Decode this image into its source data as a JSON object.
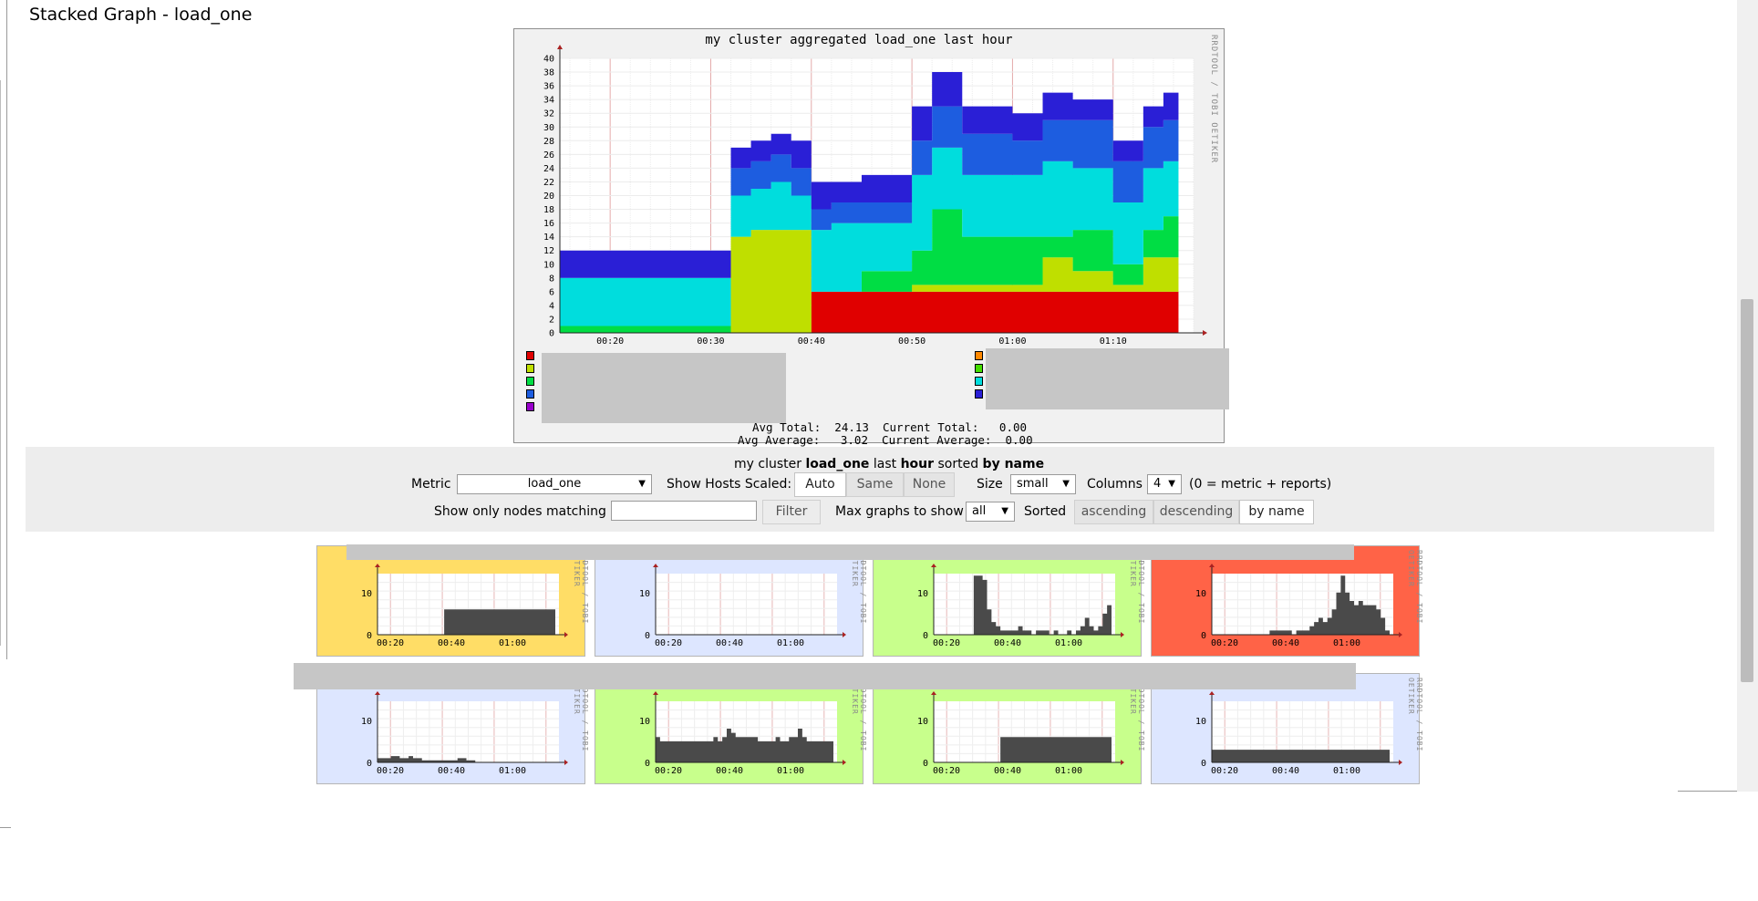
{
  "page": {
    "title": "Stacked Graph - load_one"
  },
  "main_graph": {
    "title": "my cluster aggregated load_one last hour",
    "credit": "RRDTOOL / TOBI OETIKER",
    "stats": {
      "line1": "Avg Total:  24.13  Current Total:   0.00",
      "line2": "Avg Average:   3.02  Current Average:  0.00"
    },
    "legend_colors_left": [
      "#e00000",
      "#bfdf00",
      "#00dd44",
      "#1d5de0",
      "#9900cc"
    ],
    "legend_colors_right": [
      "#ff8800",
      "#44dd00",
      "#00dddd",
      "#2a1fd6"
    ]
  },
  "chart_data": {
    "type": "area",
    "title": "my cluster aggregated load_one last hour",
    "stacked": true,
    "ylim": [
      0,
      40
    ],
    "y_ticks": [
      "0",
      "2",
      "4",
      "6",
      "8",
      "10",
      "12",
      "14",
      "16",
      "18",
      "20",
      "22",
      "24",
      "26",
      "28",
      "30",
      "32",
      "34",
      "36",
      "38",
      "40"
    ],
    "x_ticks": [
      "00:20",
      "00:30",
      "00:40",
      "00:50",
      "01:00",
      "01:10"
    ],
    "x_minutes": [
      15,
      20,
      25,
      30,
      32,
      34,
      36,
      38,
      40,
      42,
      45,
      50,
      52,
      55,
      60,
      63,
      66,
      70,
      73,
      75
    ],
    "series": [
      {
        "color": "#e00000",
        "values": [
          0,
          0,
          0,
          0,
          0,
          0,
          0,
          0,
          6,
          6,
          6,
          6,
          6,
          6,
          6,
          6,
          6,
          6,
          6,
          6
        ]
      },
      {
        "color": "#bfdf00",
        "values": [
          0,
          0,
          0,
          0,
          14,
          15,
          15,
          15,
          0,
          0,
          0,
          1,
          1,
          1,
          1,
          5,
          3,
          1,
          5,
          5
        ]
      },
      {
        "color": "#00dd44",
        "values": [
          1,
          1,
          1,
          1,
          0,
          0,
          0,
          0,
          0,
          0,
          3,
          5,
          11,
          7,
          7,
          3,
          6,
          3,
          4,
          6
        ]
      },
      {
        "color": "#00dddd",
        "values": [
          7,
          7,
          7,
          7,
          6,
          6,
          7,
          5,
          9,
          10,
          7,
          11,
          9,
          9,
          9,
          11,
          9,
          9,
          9,
          8
        ]
      },
      {
        "color": "#1d5de0",
        "values": [
          0,
          0,
          0,
          0,
          4,
          4,
          4,
          4,
          3,
          3,
          3,
          5,
          6,
          6,
          5,
          6,
          7,
          6,
          6,
          6
        ]
      },
      {
        "color": "#2a1fd6",
        "values": [
          4,
          4,
          4,
          4,
          3,
          3,
          3,
          4,
          4,
          3,
          4,
          5,
          5,
          4,
          4,
          4,
          3,
          3,
          3,
          4
        ]
      }
    ]
  },
  "controls": {
    "summary": {
      "prefix": "my cluster ",
      "metric": "load_one",
      "mid": " last ",
      "range": "hour",
      "sorted": " sorted ",
      "sort_by": "by name"
    },
    "metric_label": "Metric",
    "metric_value": "load_one",
    "scaled_label": "Show Hosts Scaled:",
    "scaled_options": [
      "Auto",
      "Same",
      "None"
    ],
    "size_label": "Size",
    "size_value": "small",
    "columns_label": "Columns",
    "columns_value": "4",
    "columns_note": "(0 = metric + reports)",
    "filter_label": "Show only nodes matching",
    "filter_value": "",
    "filter_button": "Filter",
    "max_graphs_label": "Max graphs to show",
    "max_graphs_value": "all",
    "sorted_label": "Sorted",
    "sort_options": [
      "ascending",
      "descending",
      "by name"
    ]
  },
  "thumbnails": {
    "y_ticks": [
      "0",
      "10"
    ],
    "x_ticks": [
      "00:20",
      "00:40",
      "01:00"
    ],
    "credit": "RRDTOOL / TOBI OETIKER",
    "items": [
      {
        "bg": "#ffdd66",
        "values": [
          0,
          0,
          0,
          0,
          0,
          0,
          0,
          0,
          0,
          0,
          0,
          0,
          0,
          0,
          0,
          6,
          6,
          6,
          6,
          6,
          6,
          6,
          6,
          6,
          6,
          6,
          6,
          6,
          6,
          6,
          6,
          6,
          6,
          6,
          6,
          6,
          6,
          6,
          6,
          6
        ]
      },
      {
        "bg": "#dde6ff",
        "values": [
          0,
          0,
          0,
          0,
          0,
          0,
          0,
          0,
          0,
          0,
          0,
          0,
          0,
          0,
          0,
          0,
          0,
          0,
          0,
          0,
          0,
          0,
          0,
          0,
          0,
          0,
          0,
          0,
          0,
          0,
          0,
          0,
          0,
          0,
          0,
          0,
          0,
          0,
          0,
          0
        ]
      },
      {
        "bg": "#c8ff8c",
        "values": [
          0,
          0,
          0,
          0,
          0,
          0,
          0,
          0,
          0,
          14,
          14,
          13,
          6,
          3,
          2,
          1,
          1,
          1,
          1,
          2,
          1,
          1,
          0,
          1,
          1,
          1,
          0,
          1,
          0,
          0,
          1,
          0,
          1,
          2,
          4,
          2,
          1,
          2,
          5,
          7
        ]
      },
      {
        "bg": "#ff6347",
        "values": [
          0,
          0,
          0,
          0,
          0,
          0,
          0,
          0,
          0,
          0,
          0,
          0,
          0,
          1,
          1,
          1,
          1,
          1,
          0,
          1,
          1,
          1,
          2,
          3,
          4,
          3,
          4,
          6,
          10,
          14,
          10,
          8,
          7,
          8,
          7,
          7,
          7,
          6,
          4,
          1
        ]
      },
      {
        "bg": "#dde6ff",
        "values": [
          1,
          1,
          1,
          1.5,
          1.5,
          1,
          1,
          1.5,
          1,
          1,
          0.5,
          0.5,
          0.5,
          0.5,
          0.5,
          0.5,
          0.5,
          0.5,
          1,
          1,
          0.5,
          0.5,
          0,
          0,
          0,
          0,
          0,
          0,
          0,
          0,
          0,
          0,
          0,
          0,
          0,
          0,
          0,
          0,
          0,
          0
        ]
      },
      {
        "bg": "#c8ff8c",
        "values": [
          6,
          5,
          5,
          5,
          5,
          5,
          5,
          5,
          5,
          5,
          5,
          5,
          5,
          6,
          5,
          6,
          8,
          7,
          6,
          6,
          6,
          6,
          6,
          5,
          5,
          5,
          5,
          6,
          5,
          5,
          6,
          6,
          8,
          6,
          5,
          5,
          5,
          5,
          5,
          5
        ]
      },
      {
        "bg": "#c8ff8c",
        "values": [
          0,
          0,
          0,
          0,
          0,
          0,
          0,
          0,
          0,
          0,
          0,
          0,
          0,
          0,
          0,
          6,
          6,
          6,
          6,
          6,
          6,
          6,
          6,
          6,
          6,
          6,
          6,
          6,
          6,
          6,
          6,
          6,
          6,
          6,
          6,
          6,
          6,
          6,
          6,
          6
        ]
      },
      {
        "bg": "#dde6ff",
        "values": [
          3,
          3,
          3,
          3,
          3,
          3,
          3,
          3,
          3,
          3,
          3,
          3,
          3,
          3,
          3,
          3,
          3,
          3,
          3,
          3,
          3,
          3,
          3,
          3,
          3,
          3,
          3,
          3,
          3,
          3,
          3,
          3,
          3,
          3,
          3,
          3,
          3,
          3,
          3,
          3
        ]
      }
    ]
  }
}
